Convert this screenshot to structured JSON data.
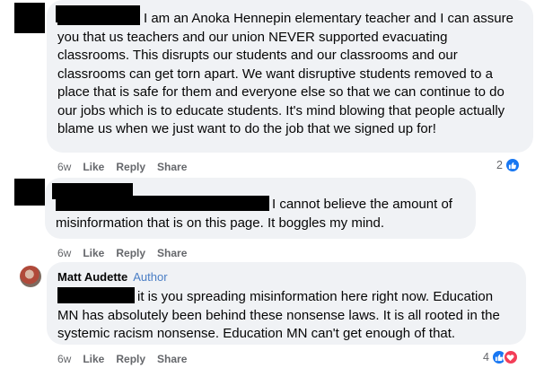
{
  "comments": [
    {
      "author": "",
      "body_first_line": "I am an Anoka Hennepin elementary teacher and I can assure",
      "body_rest": "you that us teachers and our union NEVER supported evacuating classrooms. This disrupts our students and our classrooms and our classrooms can get torn apart. We want disruptive students removed to a place that is safe for them and everyone else so that we can continue to do our jobs which is to educate students. It's mind blowing that people actually blame us when we just want to do the job that we signed up for!",
      "time": "6w",
      "like_label": "Like",
      "reply_label": "Reply",
      "share_label": "Share",
      "reaction_count": "2",
      "reaction_icons": [
        "like-icon"
      ]
    },
    {
      "author": "",
      "body_first_line": "I cannot believe the amount of",
      "body_rest": "misinformation that is on this page. It boggles my mind.",
      "time": "6w",
      "like_label": "Like",
      "reply_label": "Reply",
      "share_label": "Share"
    },
    {
      "author": "Matt Audette",
      "author_badge": "Author",
      "body_first_line": "it is you spreading misinformation here right now. Education",
      "body_rest": "MN has absolutely been behind these nonsense laws. It is all rooted in the systemic racism nonsense. Education MN can't get enough of that.",
      "time": "6w",
      "like_label": "Like",
      "reply_label": "Reply",
      "share_label": "Share",
      "reaction_count": "4",
      "reaction_icons": [
        "like-icon",
        "love-icon"
      ]
    }
  ],
  "colors": {
    "bubble": "#f0f2f5",
    "meta": "#65676b",
    "author_badge": "#4a7ec5",
    "like": "#1877f2",
    "love": "#f33e58"
  }
}
